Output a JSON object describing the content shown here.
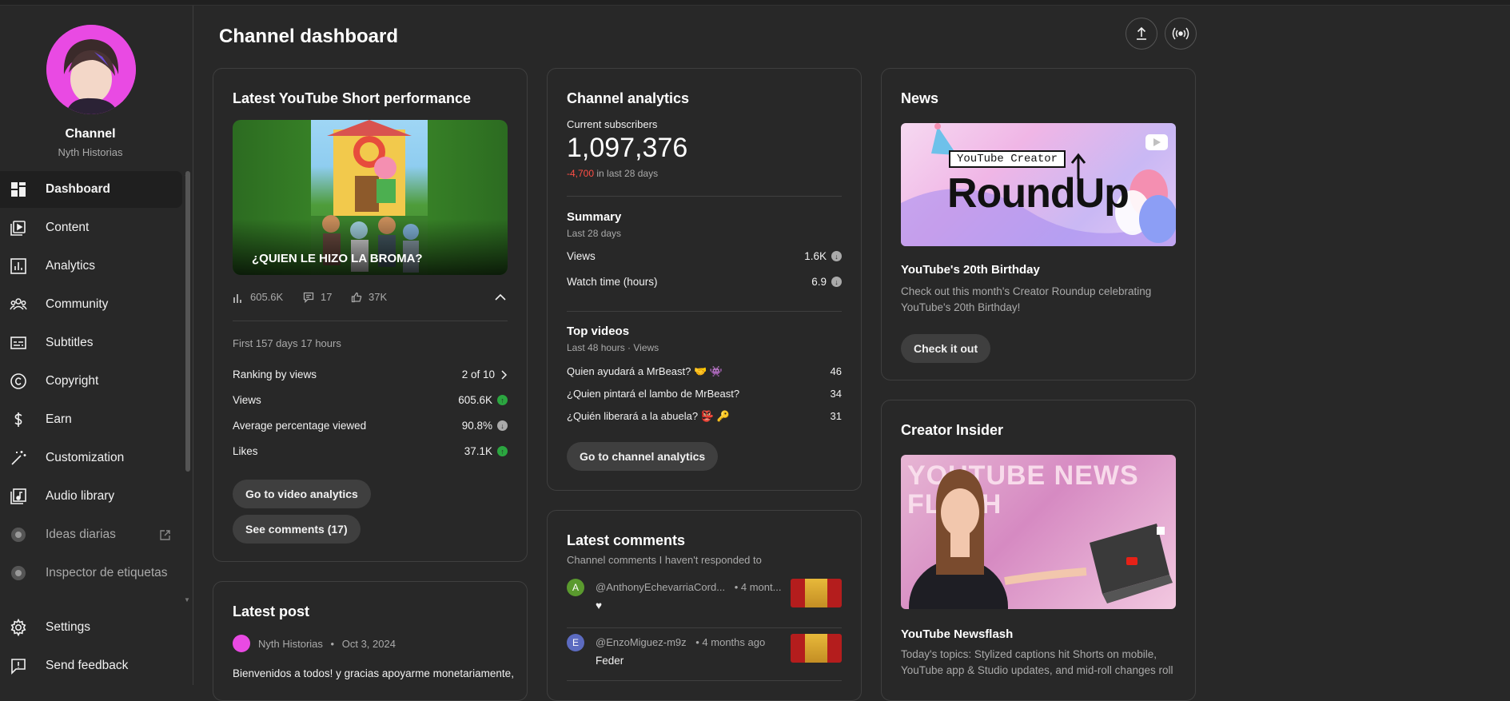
{
  "sidebar": {
    "channel_title": "Channel",
    "channel_handle": "Nyth Historias",
    "items": [
      {
        "label": "Dashboard",
        "icon": "dashboard-icon",
        "active": true
      },
      {
        "label": "Content",
        "icon": "content-icon"
      },
      {
        "label": "Analytics",
        "icon": "analytics-icon"
      },
      {
        "label": "Community",
        "icon": "community-icon"
      },
      {
        "label": "Subtitles",
        "icon": "subtitles-icon"
      },
      {
        "label": "Copyright",
        "icon": "copyright-icon"
      },
      {
        "label": "Earn",
        "icon": "earn-icon"
      },
      {
        "label": "Customization",
        "icon": "customization-icon"
      },
      {
        "label": "Audio library",
        "icon": "audio-library-icon"
      },
      {
        "label": "Ideas diarias",
        "icon": "extension-icon",
        "external": true
      },
      {
        "label": "Inspector de etiquetas",
        "icon": "extension-icon"
      }
    ],
    "settings_label": "Settings",
    "feedback_label": "Send feedback"
  },
  "header": {
    "title": "Channel dashboard"
  },
  "short_card": {
    "title": "Latest YouTube Short performance",
    "thumb_caption": "¿QUIEN LE HIZO LA BROMA?",
    "views": "605.6K",
    "comments": "17",
    "likes": "37K",
    "period": "First 157 days 17 hours",
    "metrics": [
      {
        "label": "Ranking by views",
        "value": "2 of 10"
      },
      {
        "label": "Views",
        "value": "605.6K",
        "trend": "up"
      },
      {
        "label": "Average percentage viewed",
        "value": "90.8%",
        "trend": "down"
      },
      {
        "label": "Likes",
        "value": "37.1K",
        "trend": "up"
      }
    ],
    "btn_analytics": "Go to video analytics",
    "btn_comments": "See comments (17)"
  },
  "post_card": {
    "title": "Latest post",
    "author": "Nyth Historias",
    "date": "Oct 3, 2024",
    "text": "Bienvenidos a todos! y gracias apoyarme monetariamente,"
  },
  "analytics_card": {
    "title": "Channel analytics",
    "subs_label": "Current subscribers",
    "subs_value": "1,097,376",
    "subs_change": "-4,700",
    "subs_change_suffix": "in last 28 days",
    "summary_title": "Summary",
    "summary_period": "Last 28 days",
    "summary_rows": [
      {
        "label": "Views",
        "value": "1.6K"
      },
      {
        "label": "Watch time (hours)",
        "value": "6.9"
      }
    ],
    "top_title": "Top videos",
    "top_period": "Last 48 hours · Views",
    "top_videos": [
      {
        "title": "Quien ayudará a MrBeast? 🤝 👾",
        "views": "46"
      },
      {
        "title": "¿Quien pintará el lambo de MrBeast?",
        "views": "34"
      },
      {
        "title": "¿Quién liberará a la abuela? 👺 🔑",
        "views": "31"
      }
    ],
    "btn": "Go to channel analytics"
  },
  "comments_card": {
    "title": "Latest comments",
    "subtitle": "Channel comments I haven't responded to",
    "comments": [
      {
        "initial": "A",
        "author": "@AnthonyEchevarriaCord...",
        "time": "• 4 mont...",
        "text": "♥",
        "color": "#5a9a2e"
      },
      {
        "initial": "E",
        "author": "@EnzoMiguez-m9z",
        "time": "• 4 months ago",
        "text": "Feder",
        "color": "#5c6bc0"
      }
    ]
  },
  "news_card": {
    "title": "News",
    "image_text_top": "YouTube Creator",
    "image_text_main": "RoundUp",
    "headline": "YouTube's 20th Birthday",
    "body": "Check out this month's Creator Roundup celebrating YouTube's 20th Birthday!",
    "btn": "Check it out"
  },
  "insider_card": {
    "title": "Creator Insider",
    "image_text": "YOUTUBE NEWS FLASH",
    "headline": "YouTube Newsflash",
    "body": "Today's topics: Stylized captions hit Shorts on mobile, YouTube app & Studio updates, and mid-roll changes roll"
  },
  "colors": {
    "background": "#282828",
    "border": "#3f3f3f",
    "negative": "#ff4e45",
    "positive": "#2ba640"
  }
}
